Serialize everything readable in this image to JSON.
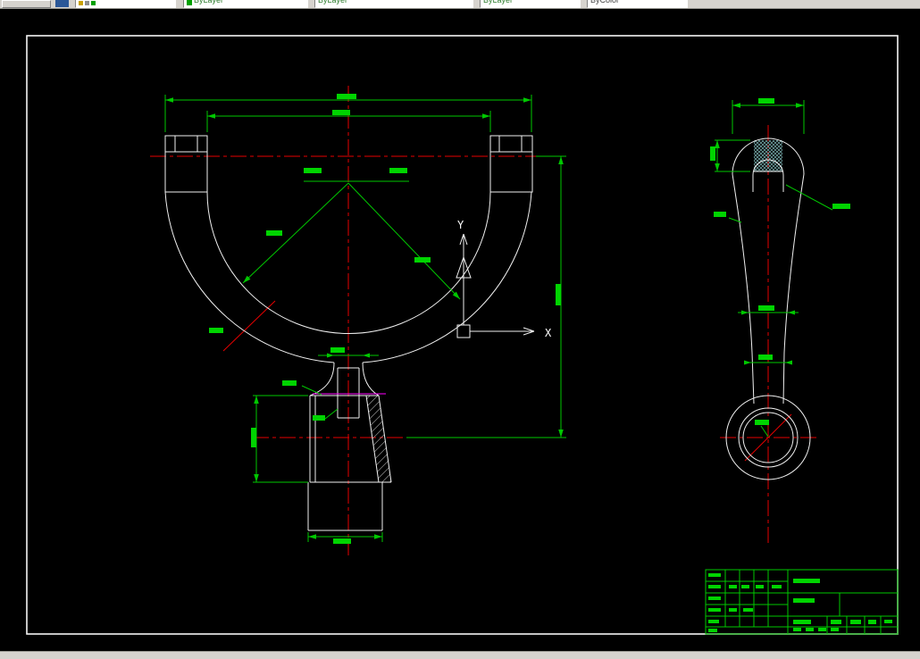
{
  "toolbar": {
    "combos": [
      {
        "name": "layer",
        "value": ""
      },
      {
        "name": "color",
        "value": "ByLayer"
      },
      {
        "name": "linetype",
        "value": "ByLayer"
      },
      {
        "name": "lineweight",
        "value": "ByLayer"
      },
      {
        "name": "plotstyle",
        "value": "ByColor"
      }
    ]
  },
  "ucs": {
    "x_label": "X",
    "y_label": "Y"
  },
  "colors": {
    "background": "#000000",
    "toolbar_bg": "#d6d3ce",
    "frame": "#f5f5f5",
    "outline": "#f0f0f0",
    "dimension": "#00c800",
    "dimension_text": "#00d400",
    "centerline": "#e60000",
    "magenta": "#ff00ff",
    "section_hatch": "#6e9e9e",
    "ucs_icon": "#ffffff"
  },
  "drawing": {
    "dim_text_marks": [
      [
        377,
        105,
        22,
        6
      ],
      [
        372,
        123,
        20,
        6
      ],
      [
        340,
        188,
        20,
        6
      ],
      [
        436,
        188,
        20,
        6
      ],
      [
        298,
        258,
        18,
        6
      ],
      [
        464,
        288,
        18,
        6
      ],
      [
        622,
        318,
        6,
        24
      ],
      [
        281,
        479,
        6,
        22
      ],
      [
        373,
        603,
        20,
        6
      ],
      [
        370,
        389,
        16,
        6
      ],
      [
        316,
        426,
        16,
        6
      ],
      [
        350,
        465,
        14,
        6
      ],
      [
        234,
        367,
        16,
        6
      ],
      [
        849,
        110,
        18,
        6
      ],
      [
        795,
        164,
        6,
        16
      ],
      [
        932,
        228,
        20,
        6
      ],
      [
        799,
        237,
        14,
        6
      ],
      [
        849,
        342,
        18,
        6
      ],
      [
        849,
        397,
        16,
        6
      ],
      [
        845,
        470,
        16,
        6
      ]
    ],
    "title_block_text_marks": [
      [
        793,
        642,
        14,
        4
      ],
      [
        793,
        655,
        14,
        4
      ],
      [
        793,
        668,
        14,
        4
      ],
      [
        793,
        681,
        14,
        4
      ],
      [
        793,
        694,
        12,
        4
      ],
      [
        793,
        704,
        10,
        4
      ],
      [
        816,
        655,
        9,
        4
      ],
      [
        830,
        655,
        9,
        4
      ],
      [
        846,
        655,
        9,
        4
      ],
      [
        864,
        655,
        11,
        4
      ],
      [
        816,
        681,
        9,
        4
      ],
      [
        832,
        681,
        11,
        4
      ],
      [
        888,
        648,
        30,
        5
      ],
      [
        888,
        670,
        24,
        5
      ],
      [
        888,
        694,
        20,
        5
      ],
      [
        930,
        694,
        12,
        5
      ],
      [
        952,
        694,
        12,
        5
      ],
      [
        972,
        694,
        9,
        5
      ],
      [
        990,
        694,
        9,
        4
      ],
      [
        888,
        703,
        9,
        4
      ],
      [
        902,
        703,
        9,
        4
      ],
      [
        916,
        703,
        9,
        4
      ],
      [
        930,
        703,
        9,
        4
      ]
    ]
  }
}
